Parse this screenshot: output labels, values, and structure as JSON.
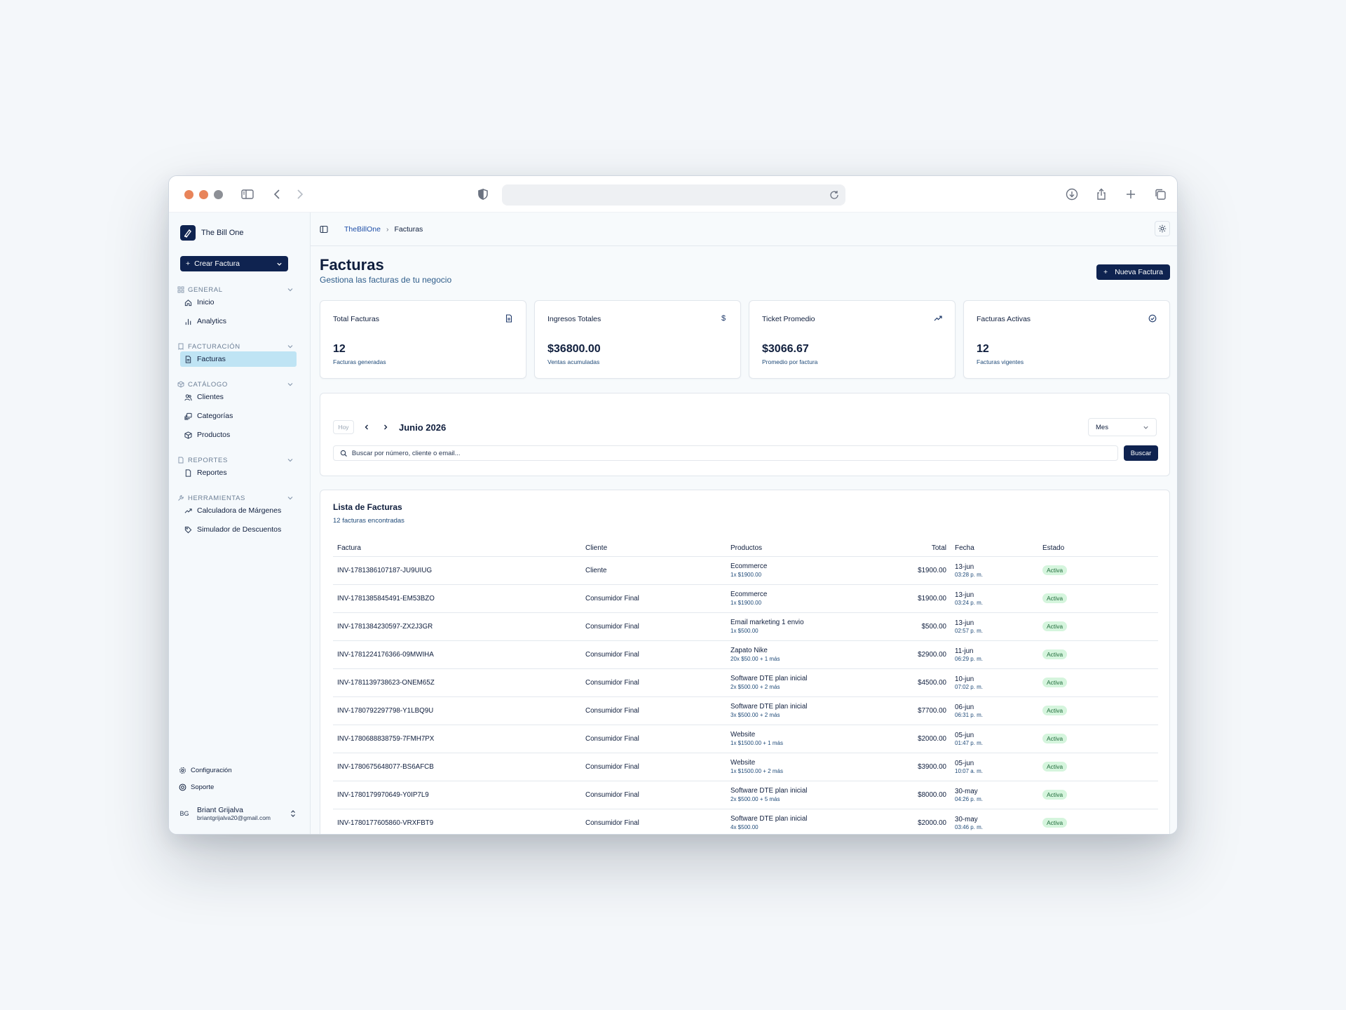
{
  "app": {
    "brand": "The Bill One"
  },
  "sidebar": {
    "create_label": "Crear Factura",
    "sections": [
      {
        "label": "GENERAL",
        "items": [
          "Inicio",
          "Analytics"
        ]
      },
      {
        "label": "FACTURACIÓN",
        "items": [
          "Facturas"
        ]
      },
      {
        "label": "CATÁLOGO",
        "items": [
          "Clientes",
          "Categorías",
          "Productos"
        ]
      },
      {
        "label": "REPORTES",
        "items": [
          "Reportes"
        ]
      },
      {
        "label": "HERRAMIENTAS",
        "items": [
          "Calculadora de Márgenes",
          "Simulador de Descuentos"
        ]
      }
    ],
    "footer": {
      "settings": "Configuración",
      "support": "Soporte"
    },
    "user": {
      "initials": "BG",
      "name": "Briant Grijalva",
      "email": "briantgrijalva20@gmail.com"
    }
  },
  "breadcrumb": {
    "root": "TheBillOne",
    "current": "Facturas"
  },
  "page": {
    "title": "Facturas",
    "subtitle": "Gestiona las facturas de tu negocio",
    "new_button": "Nueva Factura"
  },
  "stats": [
    {
      "label": "Total Facturas",
      "value": "12",
      "sub": "Facturas generadas",
      "icon": "file-icon"
    },
    {
      "label": "Ingresos Totales",
      "value": "$36800.00",
      "sub": "Ventas acumuladas",
      "icon": "dollar-icon"
    },
    {
      "label": "Ticket Promedio",
      "value": "$3066.67",
      "sub": "Promedio por factura",
      "icon": "trending-up-icon"
    },
    {
      "label": "Facturas Activas",
      "value": "12",
      "sub": "Facturas vigentes",
      "icon": "check-circle-icon"
    }
  ],
  "filters": {
    "today": "Hoy",
    "month": "Junio 2026",
    "view": "Mes",
    "search_placeholder": "Buscar por número, cliente o email...",
    "search_button": "Buscar"
  },
  "list": {
    "title": "Lista de Facturas",
    "count": "12 facturas encontradas",
    "columns": [
      "Factura",
      "Cliente",
      "Productos",
      "Total",
      "Fecha",
      "Estado"
    ],
    "rows": [
      {
        "id": "INV-1781386107187-JU9UIUG",
        "client": "Cliente",
        "product": "Ecommerce",
        "detail": "1x $1900.00",
        "total": "$1900.00",
        "date": "13-jun",
        "time": "03:28 p. m.",
        "status": "Activa"
      },
      {
        "id": "INV-1781385845491-EM53BZO",
        "client": "Consumidor Final",
        "product": "Ecommerce",
        "detail": "1x $1900.00",
        "total": "$1900.00",
        "date": "13-jun",
        "time": "03:24 p. m.",
        "status": "Activa"
      },
      {
        "id": "INV-1781384230597-ZX2J3GR",
        "client": "Consumidor Final",
        "product": "Email marketing 1 envio",
        "detail": "1x $500.00",
        "total": "$500.00",
        "date": "13-jun",
        "time": "02:57 p. m.",
        "status": "Activa"
      },
      {
        "id": "INV-1781224176366-09MWIHA",
        "client": "Consumidor Final",
        "product": "Zapato Nike",
        "detail": "20x $50.00 + 1 más",
        "total": "$2900.00",
        "date": "11-jun",
        "time": "06:29 p. m.",
        "status": "Activa"
      },
      {
        "id": "INV-1781139738623-ONEM65Z",
        "client": "Consumidor Final",
        "product": "Software DTE plan inicial",
        "detail": "2x $500.00 + 2 más",
        "total": "$4500.00",
        "date": "10-jun",
        "time": "07:02 p. m.",
        "status": "Activa"
      },
      {
        "id": "INV-1780792297798-Y1LBQ9U",
        "client": "Consumidor Final",
        "product": "Software DTE plan inicial",
        "detail": "3x $500.00 + 2 más",
        "total": "$7700.00",
        "date": "06-jun",
        "time": "06:31 p. m.",
        "status": "Activa"
      },
      {
        "id": "INV-1780688838759-7FMH7PX",
        "client": "Consumidor Final",
        "product": "Website",
        "detail": "1x $1500.00 + 1 más",
        "total": "$2000.00",
        "date": "05-jun",
        "time": "01:47 p. m.",
        "status": "Activa"
      },
      {
        "id": "INV-1780675648077-BS6AFCB",
        "client": "Consumidor Final",
        "product": "Website",
        "detail": "1x $1500.00 + 2 más",
        "total": "$3900.00",
        "date": "05-jun",
        "time": "10:07 a. m.",
        "status": "Activa"
      },
      {
        "id": "INV-1780179970649-Y0IP7L9",
        "client": "Consumidor Final",
        "product": "Software DTE plan inicial",
        "detail": "2x $500.00 + 5 más",
        "total": "$8000.00",
        "date": "30-may",
        "time": "04:26 p. m.",
        "status": "Activa"
      },
      {
        "id": "INV-1780177605860-VRXFBT9",
        "client": "Consumidor Final",
        "product": "Software DTE plan inicial",
        "detail": "4x $500.00",
        "total": "$2000.00",
        "date": "30-may",
        "time": "03:46 p. m.",
        "status": "Activa"
      }
    ]
  },
  "colors": {
    "primary": "#0f2350",
    "active_nav": "#bfe4f4",
    "badge_bg": "#d5f5dd",
    "traffic_light": "#e8845a"
  }
}
